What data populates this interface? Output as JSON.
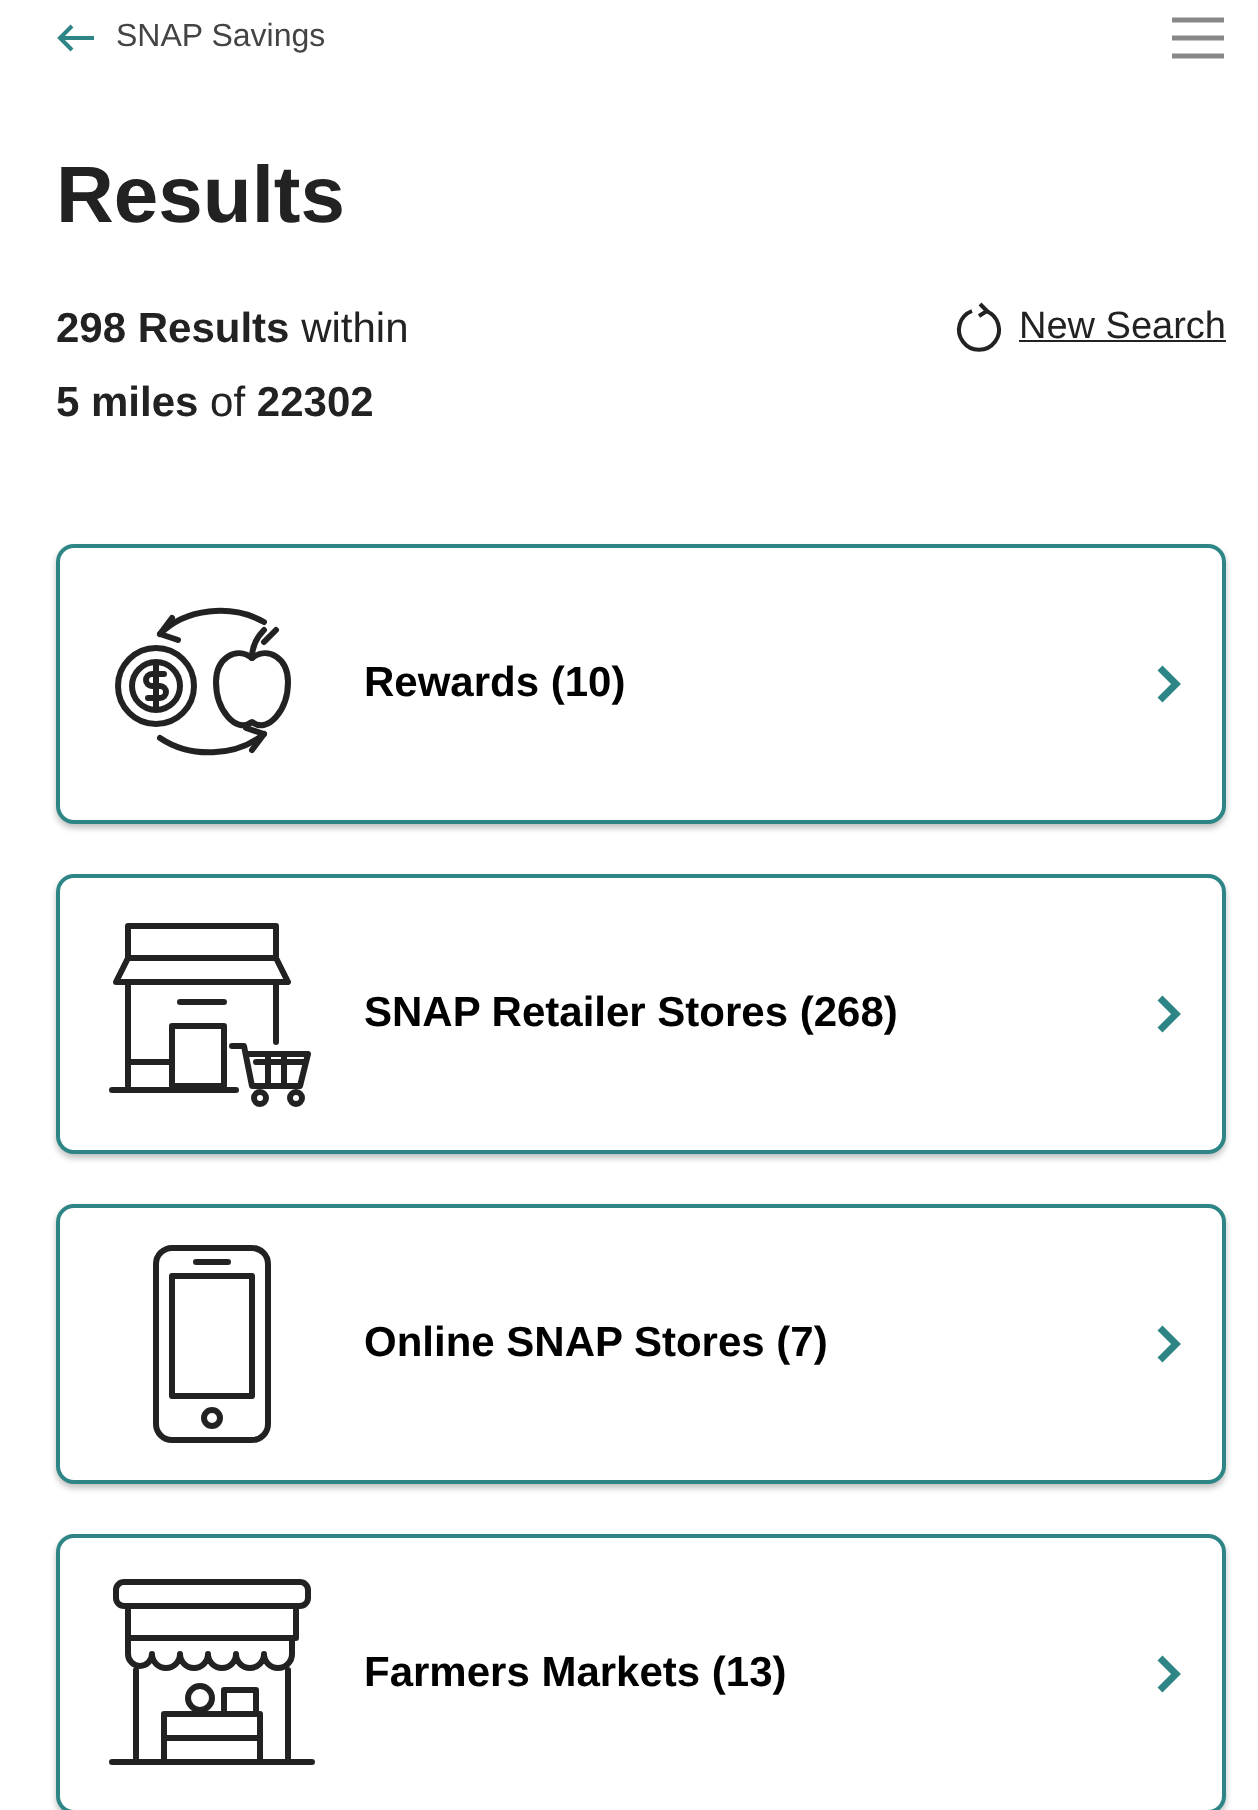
{
  "header": {
    "back_label": "SNAP Savings"
  },
  "title": "Results",
  "summary_lines": [
    "**298 Results** within",
    "**5 miles** of **22302**"
  ],
  "new_search": "New Search",
  "categories": [
    {
      "kind": "rewards",
      "label": "Rewards (10)"
    },
    {
      "kind": "retailer",
      "label": "SNAP Retailer Stores (268)"
    },
    {
      "kind": "online",
      "label": "Online SNAP Stores (7)"
    },
    {
      "kind": "market",
      "label": "Farmers Markets (13)"
    }
  ]
}
